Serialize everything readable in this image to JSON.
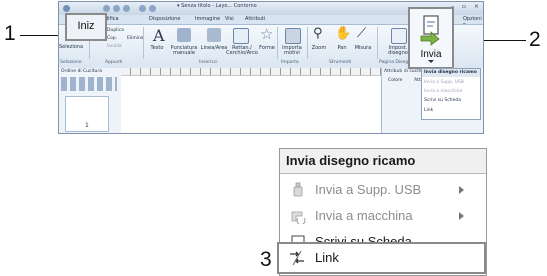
{
  "callouts": {
    "one": "1",
    "two": "2",
    "three": "3"
  },
  "window": {
    "title": "▾  Senza titolo - Layo...   Contorno",
    "controls": "– ▫ ×",
    "options_label": "Opzioni ▾",
    "tabs": [
      "difica",
      "Disposizione",
      "Immagine",
      "Visi",
      "Attributi"
    ],
    "ribbon_buttons": {
      "select": "Seleziona",
      "duplica": "Duplica",
      "elimina": "Elimina",
      "copia": "Cop.",
      "incolla": "Incolla",
      "testo": "Testo",
      "punciatura": "Punciatura manuale",
      "linea": "Linea/Area",
      "rettan": "Rettan./ Cerchio/Arco",
      "forme": "Forme",
      "importa": "Importa motivi",
      "zoom": "Zoom",
      "pan": "Pan",
      "misura": "Misura",
      "impost": "Impost. disegno"
    },
    "group_labels": [
      "Selezione",
      "Appunti",
      "Inserisci",
      "Importa",
      "Strumenti",
      "Pagina Disegno"
    ],
    "left_panel_title": "Ordine di Cucitura",
    "left_panel_number": "1",
    "right_panel_title": "Attributi di cucitura",
    "right_panel_tabs": [
      "Colore",
      "Attrib"
    ]
  },
  "iniz_button": {
    "label": "Iniz"
  },
  "invia_button": {
    "label": "Invia"
  },
  "mini_menu": {
    "header": "Invia disegno ricamo",
    "items": [
      "Invia a Supp. USB",
      "Invia a macchina",
      "Scrivi su Scheda",
      "Link"
    ]
  },
  "menu": {
    "header": "Invia disegno ricamo",
    "items": [
      {
        "label": "Invia a Supp. USB",
        "icon": "usb-icon",
        "disabled": true,
        "submenu": true
      },
      {
        "label": "Invia a macchina",
        "icon": "machine-icon",
        "disabled": true,
        "submenu": true
      },
      {
        "label": "Scrivi su Scheda",
        "icon": "card-icon",
        "disabled": false,
        "submenu": false
      },
      {
        "label": "Link",
        "icon": "link-icon",
        "disabled": false,
        "submenu": false
      }
    ]
  },
  "colors": {
    "ribbon_bg": "#dbe6f2",
    "highlight_border": "#8a8a8a",
    "disabled_text": "#8d8d8d"
  }
}
